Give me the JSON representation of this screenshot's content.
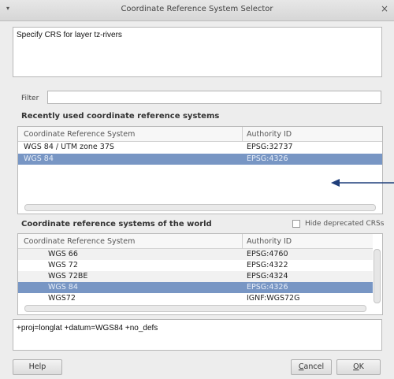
{
  "window": {
    "title": "Coordinate Reference System Selector",
    "menu_glyph": "▾",
    "close_glyph": "×"
  },
  "description": "Specify CRS for layer tz-rivers",
  "filter": {
    "label": "Filter",
    "value": ""
  },
  "recent": {
    "heading": "Recently used coordinate reference systems",
    "columns": [
      "Coordinate Reference System",
      "Authority ID"
    ],
    "rows": [
      {
        "name": "WGS 84 / UTM zone 37S",
        "authority": "EPSG:32737",
        "selected": false
      },
      {
        "name": "WGS 84",
        "authority": "EPSG:4326",
        "selected": true
      }
    ]
  },
  "world": {
    "heading": "Coordinate reference systems of the world",
    "hide_deprecated_label": "Hide deprecated CRSs",
    "hide_deprecated_checked": false,
    "columns": [
      "Coordinate Reference System",
      "Authority ID"
    ],
    "rows": [
      {
        "name": "WGS 66",
        "authority": "EPSG:4760",
        "selected": false
      },
      {
        "name": "WGS 72",
        "authority": "EPSG:4322",
        "selected": false
      },
      {
        "name": "WGS 72BE",
        "authority": "EPSG:4324",
        "selected": false
      },
      {
        "name": "WGS 84",
        "authority": "EPSG:4326",
        "selected": true
      },
      {
        "name": "WGS72",
        "authority": "IGNF:WGS72G",
        "selected": false
      }
    ]
  },
  "proj_string": "+proj=longlat +datum=WGS84 +no_defs",
  "buttons": {
    "help": "Help",
    "cancel_mnemonic": "C",
    "cancel_rest": "ancel",
    "ok_mnemonic": "O",
    "ok_rest": "K"
  },
  "colors": {
    "selection": "#7896c4",
    "annotation_arrow": "#1f3e7a"
  }
}
